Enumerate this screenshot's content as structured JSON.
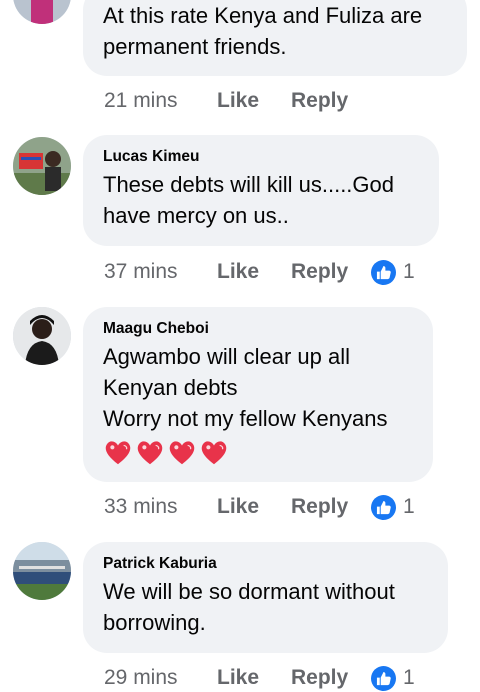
{
  "comments": [
    {
      "author": "",
      "lines": [
        "At this rate Kenya and Fuliza are",
        "permanent friends."
      ],
      "time": "21 mins",
      "like_label": "Like",
      "reply_label": "Reply",
      "reactions": null
    },
    {
      "author": "Lucas Kimeu",
      "lines": [
        "These debts will kill us.....God",
        "have mercy on us.."
      ],
      "time": "37 mins",
      "like_label": "Like",
      "reply_label": "Reply",
      "reactions": "1"
    },
    {
      "author": "Maagu Cheboi",
      "lines": [
        "Agwambo will clear up all",
        "Kenyan debts",
        "Worry not my fellow Kenyans"
      ],
      "emojis": [
        "heart-icon",
        "heart-icon",
        "heart-icon",
        "heart-icon"
      ],
      "time": "33 mins",
      "like_label": "Like",
      "reply_label": "Reply",
      "reactions": "1"
    },
    {
      "author": "Patrick Kaburia",
      "lines": [
        "We will be so dormant without",
        "borrowing."
      ],
      "time": "29 mins",
      "like_label": "Like",
      "reply_label": "Reply",
      "reactions": "1"
    }
  ],
  "colors": {
    "bubble": "#f0f2f5",
    "meta_text": "#65676b",
    "like_badge": "#1877f2",
    "heart": "#e8334a"
  }
}
